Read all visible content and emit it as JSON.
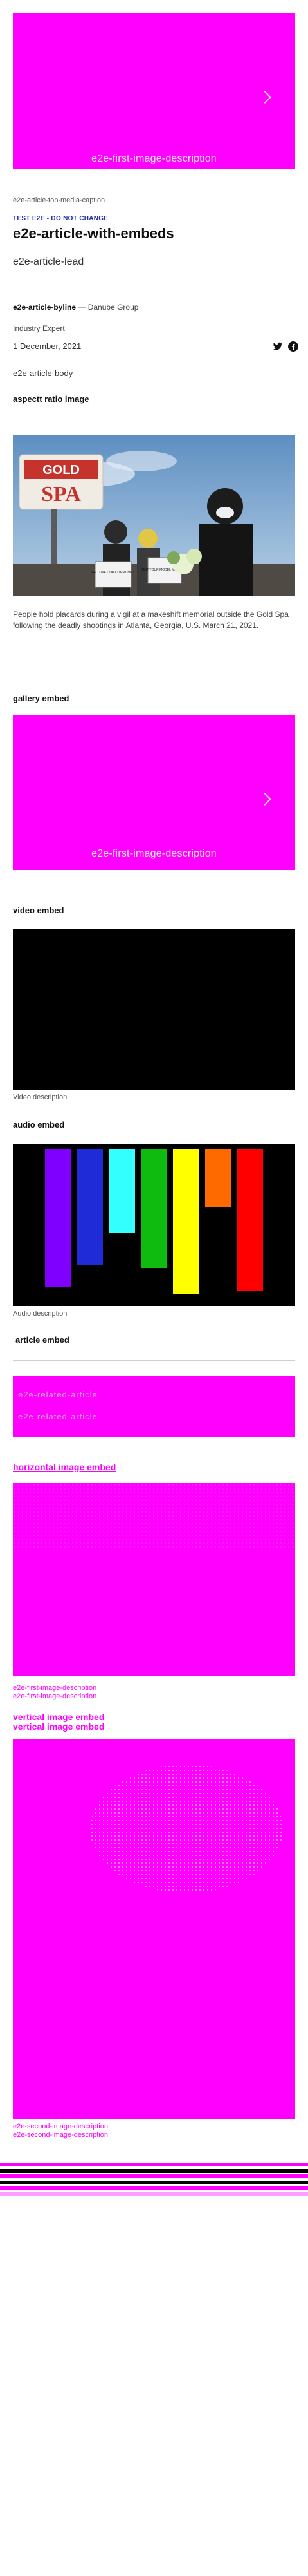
{
  "hero": {
    "caption": "e2e-first-image-description"
  },
  "top_media_caption": "e2e-article-top-media-caption",
  "kicker": "TEST E2E - DO NOT CHANGE",
  "headline": "e2e-article-with-embeds",
  "lead": "e2e-article-lead",
  "byline": {
    "name": "e2e-article-byline",
    "sep": " — ",
    "org": "Danube Group"
  },
  "author_role": "Industry Expert",
  "date": "1 December, 2021",
  "social": {
    "twitter_icon": "twitter-icon",
    "facebook_icon": "facebook-icon"
  },
  "body": "e2e-article-body",
  "aspect_ratio_title": "aspectt ratio image",
  "photo": {
    "sign_top": "GOLD",
    "sign_bottom": "SPA",
    "placard_1": "WE LOVE OUR COMMUNITY",
    "placard_2": "NOT YOUR MODEL MINORITY",
    "caption": "People hold placards during a vigil at a makeshift memorial outside the Gold Spa following the deadly shootings in Atlanta, Georgia, U.S. March 21, 2021."
  },
  "gallery_title": "gallery embed",
  "gallery_caption": "e2e-first-image-description",
  "video_title": "video embed",
  "video_description": "Video description",
  "audio_title": "audio embed",
  "audio_bars": [
    {
      "color": "#8000ff",
      "level": 0.95
    },
    {
      "color": "#1f2bd6",
      "level": 0.8
    },
    {
      "color": "#33ffff",
      "level": 0.58
    },
    {
      "color": "#10bb10",
      "level": 0.82
    },
    {
      "color": "#ffff00",
      "level": 1.0
    },
    {
      "color": "#ff6a00",
      "level": 0.4
    },
    {
      "color": "#ff0000",
      "level": 0.98
    }
  ],
  "audio_description": "Audio description",
  "article_embed_title": "article embed",
  "article_embed_lines": [
    "e2e-related-article",
    "e2e-related-article"
  ],
  "horizontal_title": "horizontal image embed",
  "horizontal_captions": [
    "e2e-first-image-description",
    "e2e-first-image-description"
  ],
  "vertical_titles": [
    "vertical image embed",
    "vertical image embed"
  ],
  "vertical_captions": [
    "e2e-second-image-description",
    "e2e-second-image-description"
  ],
  "colors": {
    "accent": "#ff00ff",
    "kicker": "#1f2aa8"
  }
}
